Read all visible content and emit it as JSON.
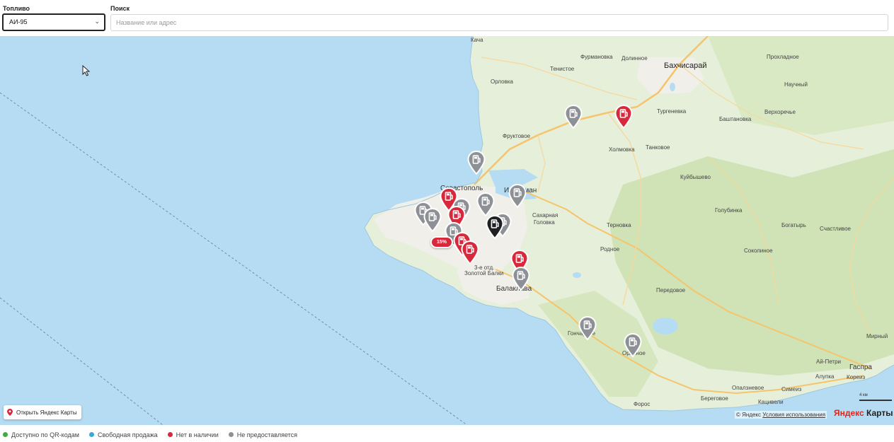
{
  "filters": {
    "fuel_label": "Топливо",
    "fuel_value": "АИ-95",
    "search_label": "Поиск",
    "search_placeholder": "Название или адрес"
  },
  "map": {
    "places": [
      {
        "name": "Кача",
        "cls": ""
      },
      {
        "name": "Фурмановка",
        "cls": ""
      },
      {
        "name": "Долинное",
        "cls": ""
      },
      {
        "name": "Бахчисарай",
        "cls": "big"
      },
      {
        "name": "Прохладное",
        "cls": ""
      },
      {
        "name": "Тенистое",
        "cls": ""
      },
      {
        "name": "Орловка",
        "cls": ""
      },
      {
        "name": "Научный",
        "cls": ""
      },
      {
        "name": "Тургеневка",
        "cls": ""
      },
      {
        "name": "Верхоречье",
        "cls": ""
      },
      {
        "name": "Фруктовое",
        "cls": ""
      },
      {
        "name": "Баштановка",
        "cls": ""
      },
      {
        "name": "Холмовка",
        "cls": ""
      },
      {
        "name": "Танковое",
        "cls": ""
      },
      {
        "name": "Куйбышево",
        "cls": ""
      },
      {
        "name": "Севастополь",
        "cls": "city"
      },
      {
        "name": "Инкерман",
        "cls": "city"
      },
      {
        "name": "Голубинка",
        "cls": ""
      },
      {
        "name": "Сахарная",
        "cls": ""
      },
      {
        "name": "Головка",
        "cls": ""
      },
      {
        "name": "Богатырь",
        "cls": ""
      },
      {
        "name": "Счастливое",
        "cls": ""
      },
      {
        "name": "Терновка",
        "cls": ""
      },
      {
        "name": "Родное",
        "cls": ""
      },
      {
        "name": "Соколиное",
        "cls": ""
      },
      {
        "name": "3-е отд.",
        "cls": ""
      },
      {
        "name": "Золотой Балки",
        "cls": ""
      },
      {
        "name": "Балаклава",
        "cls": "city"
      },
      {
        "name": "Передовое",
        "cls": ""
      },
      {
        "name": "Гончарное",
        "cls": ""
      },
      {
        "name": "Орлиное",
        "cls": ""
      },
      {
        "name": "Ай-Петри",
        "cls": ""
      },
      {
        "name": "Гаспра",
        "cls": "city"
      },
      {
        "name": "Алупка",
        "cls": ""
      },
      {
        "name": "Кореиз",
        "cls": ""
      },
      {
        "name": "Опалзневое",
        "cls": ""
      },
      {
        "name": "Симеиз",
        "cls": ""
      },
      {
        "name": "Береговое",
        "cls": ""
      },
      {
        "name": "Кацивели",
        "cls": ""
      },
      {
        "name": "Форос",
        "cls": ""
      },
      {
        "name": "Мирный",
        "cls": ""
      }
    ],
    "discount_badge": "15%",
    "open_yandex_label": "Открыть Яндекс Карты",
    "scale_label": "4 км",
    "copyright": "© Яндекс",
    "terms_link": "Условия использования",
    "logo_ya": "Яндекс",
    "logo_rest": " Карты",
    "colors": {
      "sea": "#b5dcf3",
      "land": "#e6efd9",
      "urban": "#f1efe9",
      "pin_red": "#d8283c",
      "pin_gray": "#8d9196",
      "pin_dark": "#1e2024"
    }
  },
  "legend": [
    {
      "label": "Доступно по QR-кодам",
      "color": "#3cae3c"
    },
    {
      "label": "Свободная продажа",
      "color": "#36a9d8"
    },
    {
      "label": "Нет в наличии",
      "color": "#d8283c"
    },
    {
      "label": "Не предоставляется",
      "color": "#8d9196"
    }
  ]
}
